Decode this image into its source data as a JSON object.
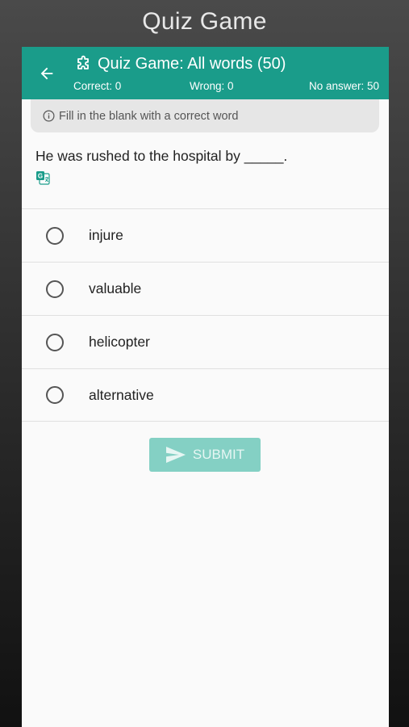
{
  "promo_title": "Quiz Game",
  "appbar": {
    "back_icon": "arrow-left-icon",
    "title_icon": "puzzle-icon",
    "title": "Quiz Game: All words (50)",
    "correct": "Correct: 0",
    "wrong": "Wrong: 0",
    "no_answer": "No answer: 50",
    "color": "#1a9c8a"
  },
  "hint": {
    "icon": "info-icon",
    "text": "Fill in the blank with a correct word"
  },
  "question": {
    "text": "He was rushed to the hospital by _____.",
    "translate_icon": "google-translate-icon"
  },
  "options": [
    {
      "label": "injure",
      "selected": false
    },
    {
      "label": "valuable",
      "selected": false
    },
    {
      "label": "helicopter",
      "selected": false
    },
    {
      "label": "alternative",
      "selected": false
    }
  ],
  "submit": {
    "label": "SUBMIT",
    "icon": "send-icon",
    "enabled": false,
    "color": "#84d0c4"
  }
}
